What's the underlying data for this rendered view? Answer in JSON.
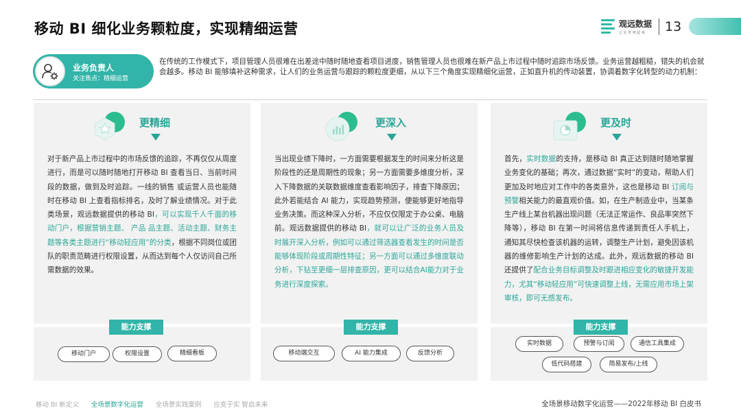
{
  "header": {
    "title": "移动 BI 细化业务颗粒度，实现精细运营",
    "brand_name": "观远数据",
    "brand_tagline": "让 业 务 用 起 来",
    "page_number": "13"
  },
  "role": {
    "title": "业务负责人",
    "focus": "关注焦点：精细运营"
  },
  "intro": "在传统的工作模式下，项目管理人员很难在出差途中随时随地查看项目进度，销售管理人员也很难在新产品上市过程中随时追踪市场反馈。业务运营越粗糙，错失的机会就会越多。移动 BI 能够填补这种需求，让人们的业务运营与跟踪的颗粒度更细，从以下三个角度实现精细化运营，正如直升机的传动装置，协调着数字化转型的动力机制：",
  "cards": [
    {
      "title": "更精细",
      "body_plain": "对于新产品上市过程中的市场反馈的追踪，不再仅仅从周度进行，而是可以随时随地打开移动 BI 查看当日、当前时间段的数据，做到及时追踪。一线的销售 或运营人员也能随时在移动 BI 上查看指标排名，及时了解业绩情况。对于此类场景，观远数据提供的移动 BI",
      "body_highlight": "，可以实现千人千面的移动门户，根据营销主题、 产品 品主题、活动主题、财务主题等各类主题进行“移动轻应用”的分类",
      "body_tail": "，根据不同岗位或团队的职责范畴进行权限设置，从而达到每个人仅访问自己所需数据的效果。",
      "support_label": "能力支撑",
      "chips": [
        "移动门户",
        "权限设置",
        "精细看板"
      ]
    },
    {
      "title": "更深入",
      "body_plain": "当出现业绩下降时，一方面需要根据发生的时间来分析这是阶段性的还是周期性的现象；另一方面需要多维度分析，深入下降数据的关联数据维度查看影响因子，排查下降原因；此外若能结合 AI 能力，实现趋势预测，便能够更好地指导业务决策。而这种深入分析，不应仅仅限定于办公桌、电脑前。观远数据提供的移动 BI",
      "body_highlight": "，就可以让广泛的业务人员及时展开深入分析，例如可以通过筛选器查看发生的时间是否能够体现阶段或周期性特征；另一方面可以通过多维度联动分析，下钻至更细一层排查原因，更可以结合AI能力对于业务进行深度探索。",
      "support_label": "能力支撑",
      "chips": [
        "移动端交互",
        "AI 能力集成",
        "反馈分析"
      ]
    },
    {
      "title": "更及时",
      "body_p1": "首先，",
      "body_h1": "实时数据",
      "body_p2": "的支持，是移动 BI 真正达到随时随地掌握业务变化的基础；再次，通过数据“实时”的变动，帮助人们更加及时地应对工作中的各类意外，这也是移动 BI ",
      "body_h2": "订阅与预警",
      "body_p3": "相关能力的最直观价值。如，在生产制造业中，当某条生产线上某台机器出现问题（无法正常运作、良品率突然下降等），移动 BI 在第一时间将信息传递到责任人手机上，通知其尽快检查该机器的运转，调整生产计划，避免因该机器的维修影响生产计划的达成。此外，观远数据的移动 BI 还提供了",
      "body_h3": "配合业务目标调整及时跟进相应变化的敏捷开发能力，尤其“移动轻应用”可快速调整上线，无需应用市场上架审核，即可无感发布。",
      "support_label": "能力支撑",
      "chips": [
        "实时数据",
        "预警与订阅",
        "通信工具集成",
        "低代码搭建",
        "简易发布/上线"
      ]
    }
  ],
  "footer": {
    "nav": [
      "移动 BI 新定义",
      "全场景数字化运营",
      "全场景实践案例",
      "应变于实  智启未来"
    ],
    "active_index": 1,
    "right_text": "全场景移动数字化运营——2022年移动 BI 白皮书"
  },
  "colors": {
    "accent": "#2ba597",
    "pill": "#32b4a8",
    "panel": "#f2f2f2"
  }
}
